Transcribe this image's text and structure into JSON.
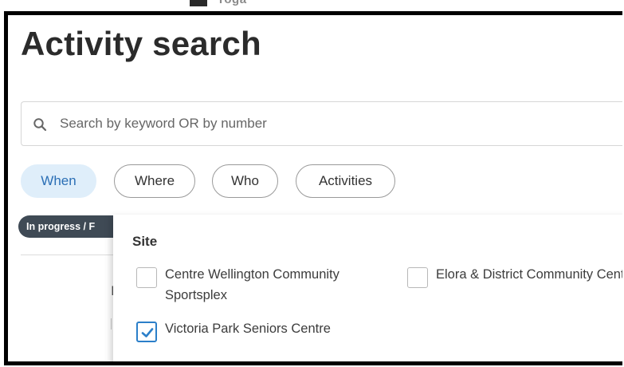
{
  "header_strip": {
    "cut_text": "Yoga"
  },
  "page": {
    "title": "Activity search"
  },
  "search": {
    "placeholder": "Search by keyword OR by number",
    "icon": "search-icon"
  },
  "filters": {
    "chips": [
      {
        "label": "When",
        "active": true
      },
      {
        "label": "Where",
        "active": false
      },
      {
        "label": "Who",
        "active": false
      },
      {
        "label": "Activities",
        "active": false
      }
    ]
  },
  "status_pill": {
    "label": "In progress / F"
  },
  "background_hint": {
    "char": "I"
  },
  "site_panel": {
    "heading": "Site",
    "options": [
      {
        "label": "Centre Wellington Community Sportsplex",
        "checked": false
      },
      {
        "label": "Elora & District Community Centre",
        "checked": false
      },
      {
        "label": "Victoria Park Seniors Centre",
        "checked": true
      }
    ]
  },
  "colors": {
    "accent": "#2b7fc9",
    "chip_active_bg": "#dfeefa",
    "pill_bg": "#3f4a55"
  }
}
